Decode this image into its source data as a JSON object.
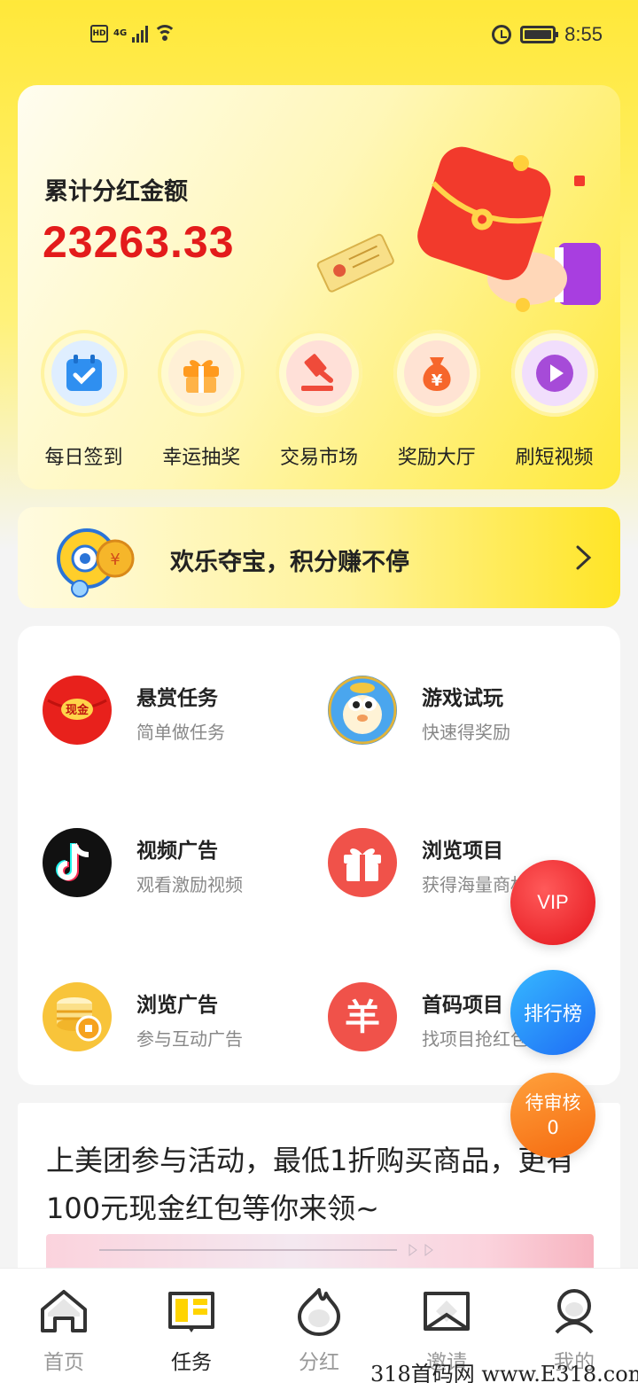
{
  "status_bar": {
    "hd": "HD",
    "network": "4G",
    "time": "8:55"
  },
  "hero": {
    "title": "累计分红金额",
    "amount": "23263.33"
  },
  "quick_actions": [
    {
      "label": "每日签到",
      "icon": "calendar-check-icon",
      "color": "#2f8ff0"
    },
    {
      "label": "幸运抽奖",
      "icon": "gift-box-icon",
      "color": "#ff9a1e"
    },
    {
      "label": "交易市场",
      "icon": "gavel-icon",
      "color": "#ef4b3a"
    },
    {
      "label": "奖励大厅",
      "icon": "money-bag-icon",
      "color": "#f6662b"
    },
    {
      "label": "刷短视频",
      "icon": "play-icon",
      "color": "#a64bd8"
    }
  ],
  "banner": {
    "text": "欢乐夺宝，积分赚不停"
  },
  "tasks": [
    {
      "title": "悬赏任务",
      "subtitle": "简单做任务",
      "icon": "red-envelope-icon",
      "icon_text": "现金"
    },
    {
      "title": "游戏试玩",
      "subtitle": "快速得奖励",
      "icon": "pufferfish-game-icon"
    },
    {
      "title": "视频广告",
      "subtitle": "观看激励视频",
      "icon": "tiktok-icon"
    },
    {
      "title": "浏览项目",
      "subtitle": "获得海量商机",
      "icon": "gift-icon"
    },
    {
      "title": "浏览广告",
      "subtitle": "参与互动广告",
      "icon": "coin-stack-icon"
    },
    {
      "title": "首码项目",
      "subtitle": "找项目抢红包",
      "icon": "yuan-icon",
      "icon_text": "羊"
    }
  ],
  "article": {
    "text": "上美团参与活动，最低1折购买商品，更有100元现金红包等你来领~"
  },
  "floating": {
    "vip": "VIP",
    "rank": "排行榜",
    "review_label": "待审核",
    "review_count": "0"
  },
  "tabs": [
    {
      "label": "首页",
      "icon": "home-icon"
    },
    {
      "label": "任务",
      "icon": "task-book-icon",
      "active": true
    },
    {
      "label": "分红",
      "icon": "flame-icon"
    },
    {
      "label": "邀请",
      "icon": "invite-envelope-icon"
    },
    {
      "label": "我的",
      "icon": "profile-icon"
    }
  ],
  "watermark": "318首码网 www.E318.com"
}
